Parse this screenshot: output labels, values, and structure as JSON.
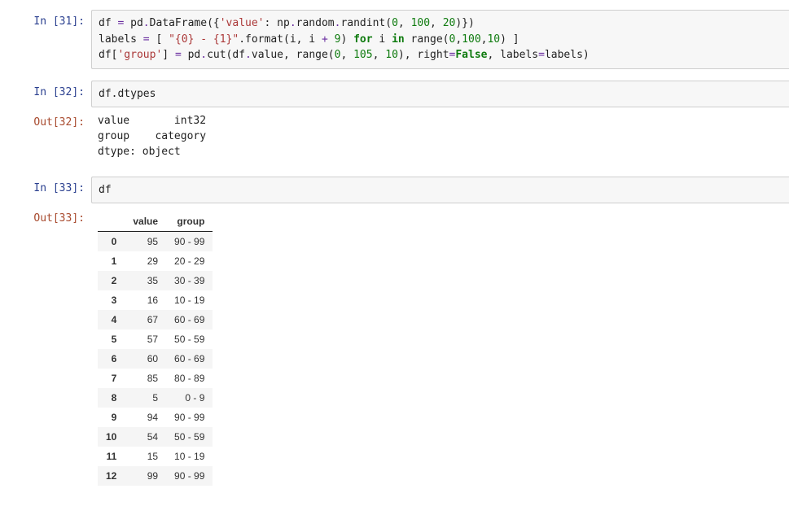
{
  "cells": {
    "c31": {
      "in_prompt": "In  [31]:",
      "code": {
        "l1_a": "df ",
        "l1_eq": "=",
        "l1_b": " pd",
        "l1_c": "DataFrame({",
        "l1_s1": "'value'",
        "l1_d": ": np",
        "l1_e": "random",
        "l1_f": "randint(",
        "l1_n1": "0",
        "l1_n2": "100",
        "l1_n3": "20",
        "l1_g": ")})",
        "l2_a": "labels ",
        "l2_eq": "=",
        "l2_b": " [ ",
        "l2_s1": "\"{0} - {1}\"",
        "l2_c": ".format(i, i ",
        "l2_plus": "+",
        "l2_n1": "9",
        "l2_d": ") ",
        "l2_for": "for",
        "l2_e": " i ",
        "l2_in": "in",
        "l2_f": " range(",
        "l2_n2": "0",
        "l2_n3": "100",
        "l2_n4": "10",
        "l2_g": ") ]",
        "l3_a": "df[",
        "l3_s1": "'group'",
        "l3_b": "] ",
        "l3_eq": "=",
        "l3_c": " pd",
        "l3_d": "cut(df",
        "l3_e": "value, range(",
        "l3_n1": "0",
        "l3_n2": "105",
        "l3_n3": "10",
        "l3_f": "), right",
        "l3_eq2": "=",
        "l3_false": "False",
        "l3_g": ", labels",
        "l3_eq3": "=",
        "l3_h": "labels)"
      }
    },
    "c32": {
      "in_prompt": "In  [32]:",
      "code": "df.dtypes",
      "out_prompt": "Out[32]:",
      "output": "value       int32\ngroup    category\ndtype: object"
    },
    "c33": {
      "in_prompt": "In  [33]:",
      "code": "df",
      "out_prompt": "Out[33]:",
      "table": {
        "columns": [
          "value",
          "group"
        ],
        "rows": [
          {
            "idx": "0",
            "value": "95",
            "group": "90 - 99"
          },
          {
            "idx": "1",
            "value": "29",
            "group": "20 - 29"
          },
          {
            "idx": "2",
            "value": "35",
            "group": "30 - 39"
          },
          {
            "idx": "3",
            "value": "16",
            "group": "10 - 19"
          },
          {
            "idx": "4",
            "value": "67",
            "group": "60 - 69"
          },
          {
            "idx": "5",
            "value": "57",
            "group": "50 - 59"
          },
          {
            "idx": "6",
            "value": "60",
            "group": "60 - 69"
          },
          {
            "idx": "7",
            "value": "85",
            "group": "80 - 89"
          },
          {
            "idx": "8",
            "value": "5",
            "group": "0 - 9"
          },
          {
            "idx": "9",
            "value": "94",
            "group": "90 - 99"
          },
          {
            "idx": "10",
            "value": "54",
            "group": "50 - 59"
          },
          {
            "idx": "11",
            "value": "15",
            "group": "10 - 19"
          },
          {
            "idx": "12",
            "value": "99",
            "group": "90 - 99"
          }
        ]
      }
    }
  },
  "misc": {
    "dot": ".",
    "comma_sp": ", ",
    "comma": ","
  }
}
